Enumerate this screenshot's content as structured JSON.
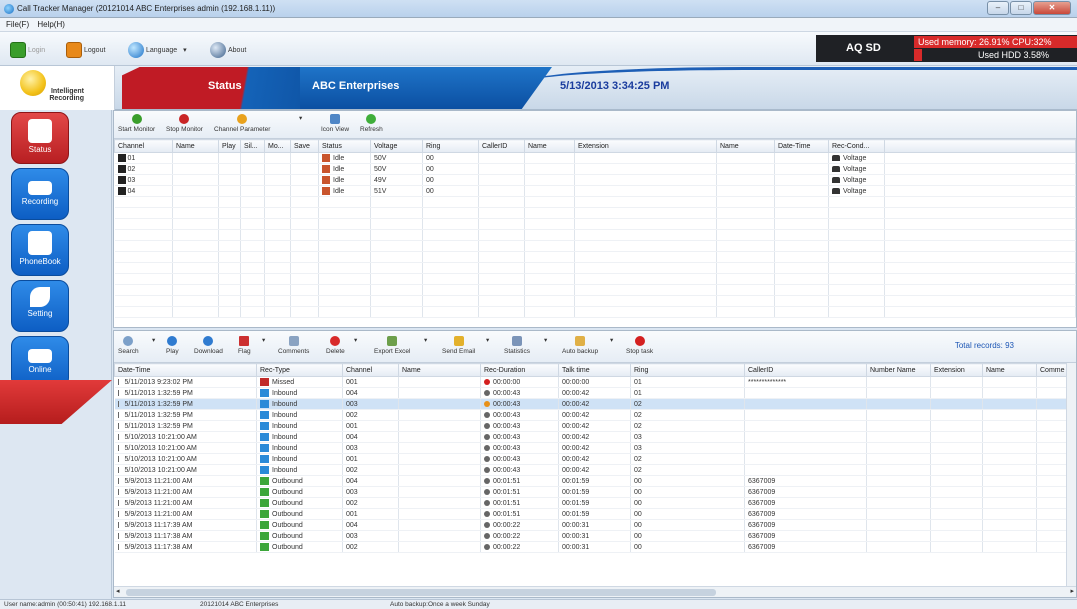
{
  "window": {
    "title": "Call Tracker Manager (20121014 ABC Enterprises admin (192.168.1.11))"
  },
  "menu": [
    "File(F)",
    "Help(H)"
  ],
  "toolbar": {
    "login": "Login",
    "logout": "Logout",
    "language": "Language",
    "about": "About"
  },
  "account": {
    "name": "AQ SD",
    "memory": "Used memory: 26.91% CPU:32%",
    "hdd": "Used HDD 3.58%"
  },
  "banner": {
    "logo_line1": "Intelligent",
    "logo_line2": "Recording",
    "status": "Status",
    "company": "ABC Enterprises",
    "datetime": "5/13/2013 3:34:25 PM"
  },
  "nav": [
    "Status",
    "Recording",
    "PhoneBook",
    "Setting",
    "Online"
  ],
  "channel_toolbar": [
    "Start Monitor",
    "Stop Monitor",
    "Channel Parameter",
    "Icon View",
    "Refresh"
  ],
  "channel_table": {
    "columns": [
      "Channel",
      "Name",
      "Play",
      "Sil...",
      "Mo...",
      "Save",
      "Status",
      "Voltage",
      "Ring",
      "CallerID",
      "Name",
      "Extension",
      "Name",
      "Date-Time",
      "Rec-Cond..."
    ],
    "rows": [
      {
        "channel": "01",
        "status": "Idle",
        "voltage": "50V",
        "ring": "00",
        "cond": "Voltage"
      },
      {
        "channel": "02",
        "status": "Idle",
        "voltage": "50V",
        "ring": "00",
        "cond": "Voltage"
      },
      {
        "channel": "03",
        "status": "Idle",
        "voltage": "49V",
        "ring": "00",
        "cond": "Voltage"
      },
      {
        "channel": "04",
        "status": "Idle",
        "voltage": "51V",
        "ring": "00",
        "cond": "Voltage"
      }
    ]
  },
  "record_toolbar": [
    "Search",
    "Play",
    "Download",
    "Flag",
    "Comments",
    "Delete",
    "Export Excel",
    "Send Email",
    "Statistics",
    "Auto backup",
    "Stop task"
  ],
  "total_records": "Total records: 93",
  "record_table": {
    "columns": [
      "Date-Time",
      "Rec-Type",
      "Channel",
      "Name",
      "Rec-Duration",
      "Talk time",
      "Ring",
      "CallerID",
      "Number Name",
      "Extension",
      "Name",
      "Comme"
    ],
    "rows": [
      {
        "dt": "5/11/2013 9:23:02 PM",
        "type": "Missed",
        "ch": "001",
        "dur": "00:00:00",
        "talk": "00:00:00",
        "ring": "01",
        "cid": "**************"
      },
      {
        "dt": "5/11/2013 1:32:59 PM",
        "type": "Inbound",
        "ch": "004",
        "dur": "00:00:43",
        "talk": "00:00:42",
        "ring": "01",
        "cid": ""
      },
      {
        "dt": "5/11/2013 1:32:59 PM",
        "type": "Inbound",
        "ch": "003",
        "dur": "00:00:43",
        "talk": "00:00:42",
        "ring": "02",
        "cid": ""
      },
      {
        "dt": "5/11/2013 1:32:59 PM",
        "type": "Inbound",
        "ch": "002",
        "dur": "00:00:43",
        "talk": "00:00:42",
        "ring": "02",
        "cid": ""
      },
      {
        "dt": "5/11/2013 1:32:59 PM",
        "type": "Inbound",
        "ch": "001",
        "dur": "00:00:43",
        "talk": "00:00:42",
        "ring": "02",
        "cid": ""
      },
      {
        "dt": "5/10/2013 10:21:00 AM",
        "type": "Inbound",
        "ch": "004",
        "dur": "00:00:43",
        "talk": "00:00:42",
        "ring": "03",
        "cid": ""
      },
      {
        "dt": "5/10/2013 10:21:00 AM",
        "type": "Inbound",
        "ch": "003",
        "dur": "00:00:43",
        "talk": "00:00:42",
        "ring": "03",
        "cid": ""
      },
      {
        "dt": "5/10/2013 10:21:00 AM",
        "type": "Inbound",
        "ch": "001",
        "dur": "00:00:43",
        "talk": "00:00:42",
        "ring": "02",
        "cid": ""
      },
      {
        "dt": "5/10/2013 10:21:00 AM",
        "type": "Inbound",
        "ch": "002",
        "dur": "00:00:43",
        "talk": "00:00:42",
        "ring": "02",
        "cid": ""
      },
      {
        "dt": "5/9/2013 11:21:00 AM",
        "type": "Outbound",
        "ch": "004",
        "dur": "00:01:51",
        "talk": "00:01:59",
        "ring": "00",
        "cid": "6367009"
      },
      {
        "dt": "5/9/2013 11:21:00 AM",
        "type": "Outbound",
        "ch": "003",
        "dur": "00:01:51",
        "talk": "00:01:59",
        "ring": "00",
        "cid": "6367009"
      },
      {
        "dt": "5/9/2013 11:21:00 AM",
        "type": "Outbound",
        "ch": "002",
        "dur": "00:01:51",
        "talk": "00:01:59",
        "ring": "00",
        "cid": "6367009"
      },
      {
        "dt": "5/9/2013 11:21:00 AM",
        "type": "Outbound",
        "ch": "001",
        "dur": "00:01:51",
        "talk": "00:01:59",
        "ring": "00",
        "cid": "6367009"
      },
      {
        "dt": "5/9/2013 11:17:39 AM",
        "type": "Outbound",
        "ch": "004",
        "dur": "00:00:22",
        "talk": "00:00:31",
        "ring": "00",
        "cid": "6367009"
      },
      {
        "dt": "5/9/2013 11:17:38 AM",
        "type": "Outbound",
        "ch": "003",
        "dur": "00:00:22",
        "talk": "00:00:31",
        "ring": "00",
        "cid": "6367009"
      },
      {
        "dt": "5/9/2013 11:17:38 AM",
        "type": "Outbound",
        "ch": "002",
        "dur": "00:00:22",
        "talk": "00:00:31",
        "ring": "00",
        "cid": "6367009"
      }
    ]
  },
  "statusbar": {
    "user": "User name:admin (00:50:41) 192.168.1.11",
    "company": "20121014 ABC Enterprises",
    "backup": "Auto backup:Once a week Sunday"
  }
}
